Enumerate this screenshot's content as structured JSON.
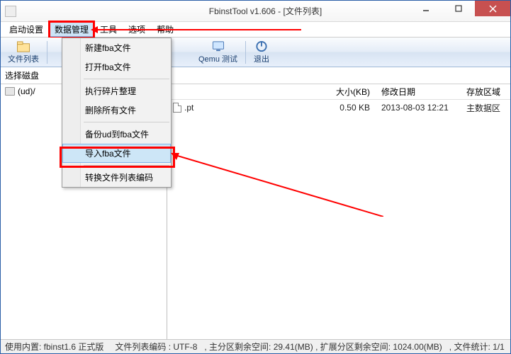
{
  "title": "FbinstTool v1.606 - [文件列表]",
  "menubar": {
    "items": [
      "启动设置",
      "数据管理",
      "工具",
      "选项",
      "帮助"
    ],
    "active_index": 1
  },
  "toolbar": {
    "file_list_label": "文件列表",
    "qemu_label": "Qemu 测试",
    "exit_label": "退出"
  },
  "selector_label": "选择磁盘",
  "tree": {
    "root_label": "(ud)/"
  },
  "columns": {
    "size": "大小(KB)",
    "date": "修改日期",
    "area": "存放区域"
  },
  "rows": [
    {
      "name": ".pt",
      "size": "0.50 KB",
      "date": "2013-08-03 12:21",
      "area": "主数据区"
    }
  ],
  "dropdown": {
    "items": [
      "新建fba文件",
      "打开fba文件",
      "__sep__",
      "执行碎片整理",
      "删除所有文件",
      "__sep__",
      "备份ud到fba文件",
      "导入fba文件",
      "__sep__",
      "转换文件列表编码"
    ],
    "hover_index": 7
  },
  "statusbar": {
    "engine": "使用内置: fbinst1.6 正式版",
    "encoding": "文件列表编码 : UTF-8",
    "space": ", 主分区剩余空间:    29.41(MB) , 扩展分区剩余空间:    1024.00(MB)",
    "count": ", 文件统计: 1/1"
  }
}
